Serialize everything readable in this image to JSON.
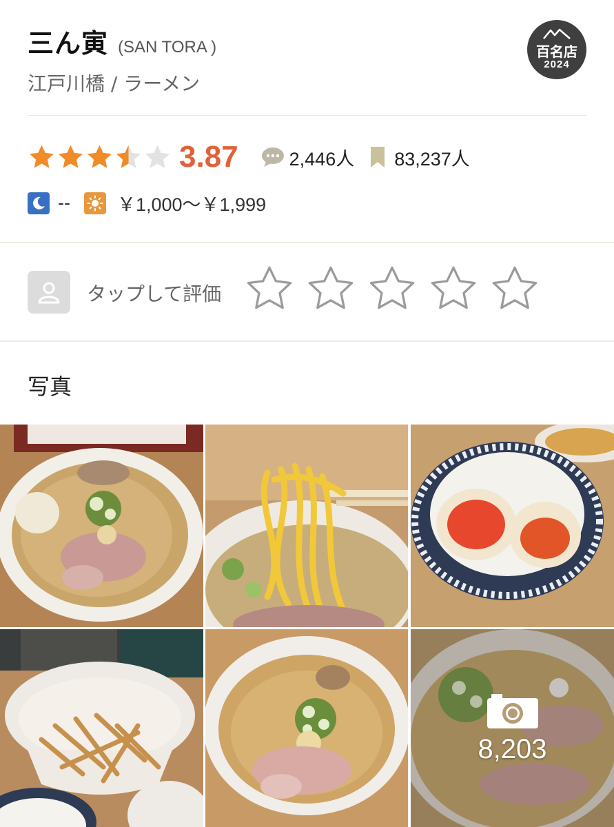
{
  "shop": {
    "name": "三ん寅",
    "romaji": "(SAN TORA )",
    "subtitle": "江戸川橋 / ラーメン",
    "badge_line1": "百名店",
    "badge_line2": "2024"
  },
  "rating": {
    "score": "3.87",
    "stars_value": 3.5,
    "reviews": "2,446人",
    "saves": "83,237人",
    "colors": {
      "star": "#f08b27",
      "empty": "#e2e2e2",
      "score": "#e0623a"
    }
  },
  "price": {
    "dinner": "--",
    "lunch": "￥1,000～￥1,999"
  },
  "rate_prompt": {
    "label": "タップして評価",
    "star_count": 5
  },
  "photos": {
    "title": "写真",
    "count": "8,203",
    "items": [
      "ramen-bowl-egg-chashu",
      "noodles-lifted-chopsticks",
      "rice-bowl-soft-egg",
      "menma-bowl",
      "ramen-bowl-ginger",
      "ramen-bowl-camera-overlay"
    ]
  }
}
